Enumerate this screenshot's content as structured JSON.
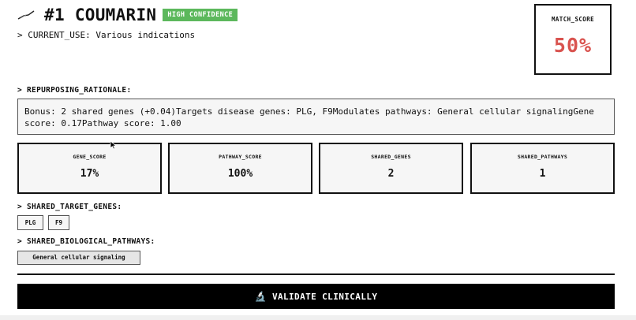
{
  "header": {
    "title": "#1 COUMARIN",
    "confidence_badge": "HIGH CONFIDENCE",
    "current_use": "> CURRENT_USE: Various indications",
    "badge_color": "#5cb85c",
    "logo_icon": "molecule-glyph-icon"
  },
  "match_score": {
    "label": "MATCH_SCORE",
    "value": "50%",
    "color": "#d9534f"
  },
  "rationale": {
    "label": "> REPURPOSING_RATIONALE:",
    "text": "Bonus: 2 shared genes (+0.04)Targets disease genes: PLG, F9Modulates pathways: General cellular signalingGene score: 0.17Pathway score: 1.00"
  },
  "metrics": [
    {
      "label": "GENE_SCORE",
      "value": "17%"
    },
    {
      "label": "PATHWAY_SCORE",
      "value": "100%"
    },
    {
      "label": "SHARED_GENES",
      "value": "2"
    },
    {
      "label": "SHARED_PATHWAYS",
      "value": "1"
    }
  ],
  "shared_genes": {
    "label": "> SHARED_TARGET_GENES:",
    "items": [
      "PLG",
      "F9"
    ]
  },
  "shared_pathways": {
    "label": "> SHARED_BIOLOGICAL_PATHWAYS:",
    "items": [
      "General cellular signaling"
    ]
  },
  "actions": {
    "validate_label": "VALIDATE CLINICALLY",
    "validate_icon": "microscope-icon",
    "validate_icon_glyph": "🔬"
  }
}
